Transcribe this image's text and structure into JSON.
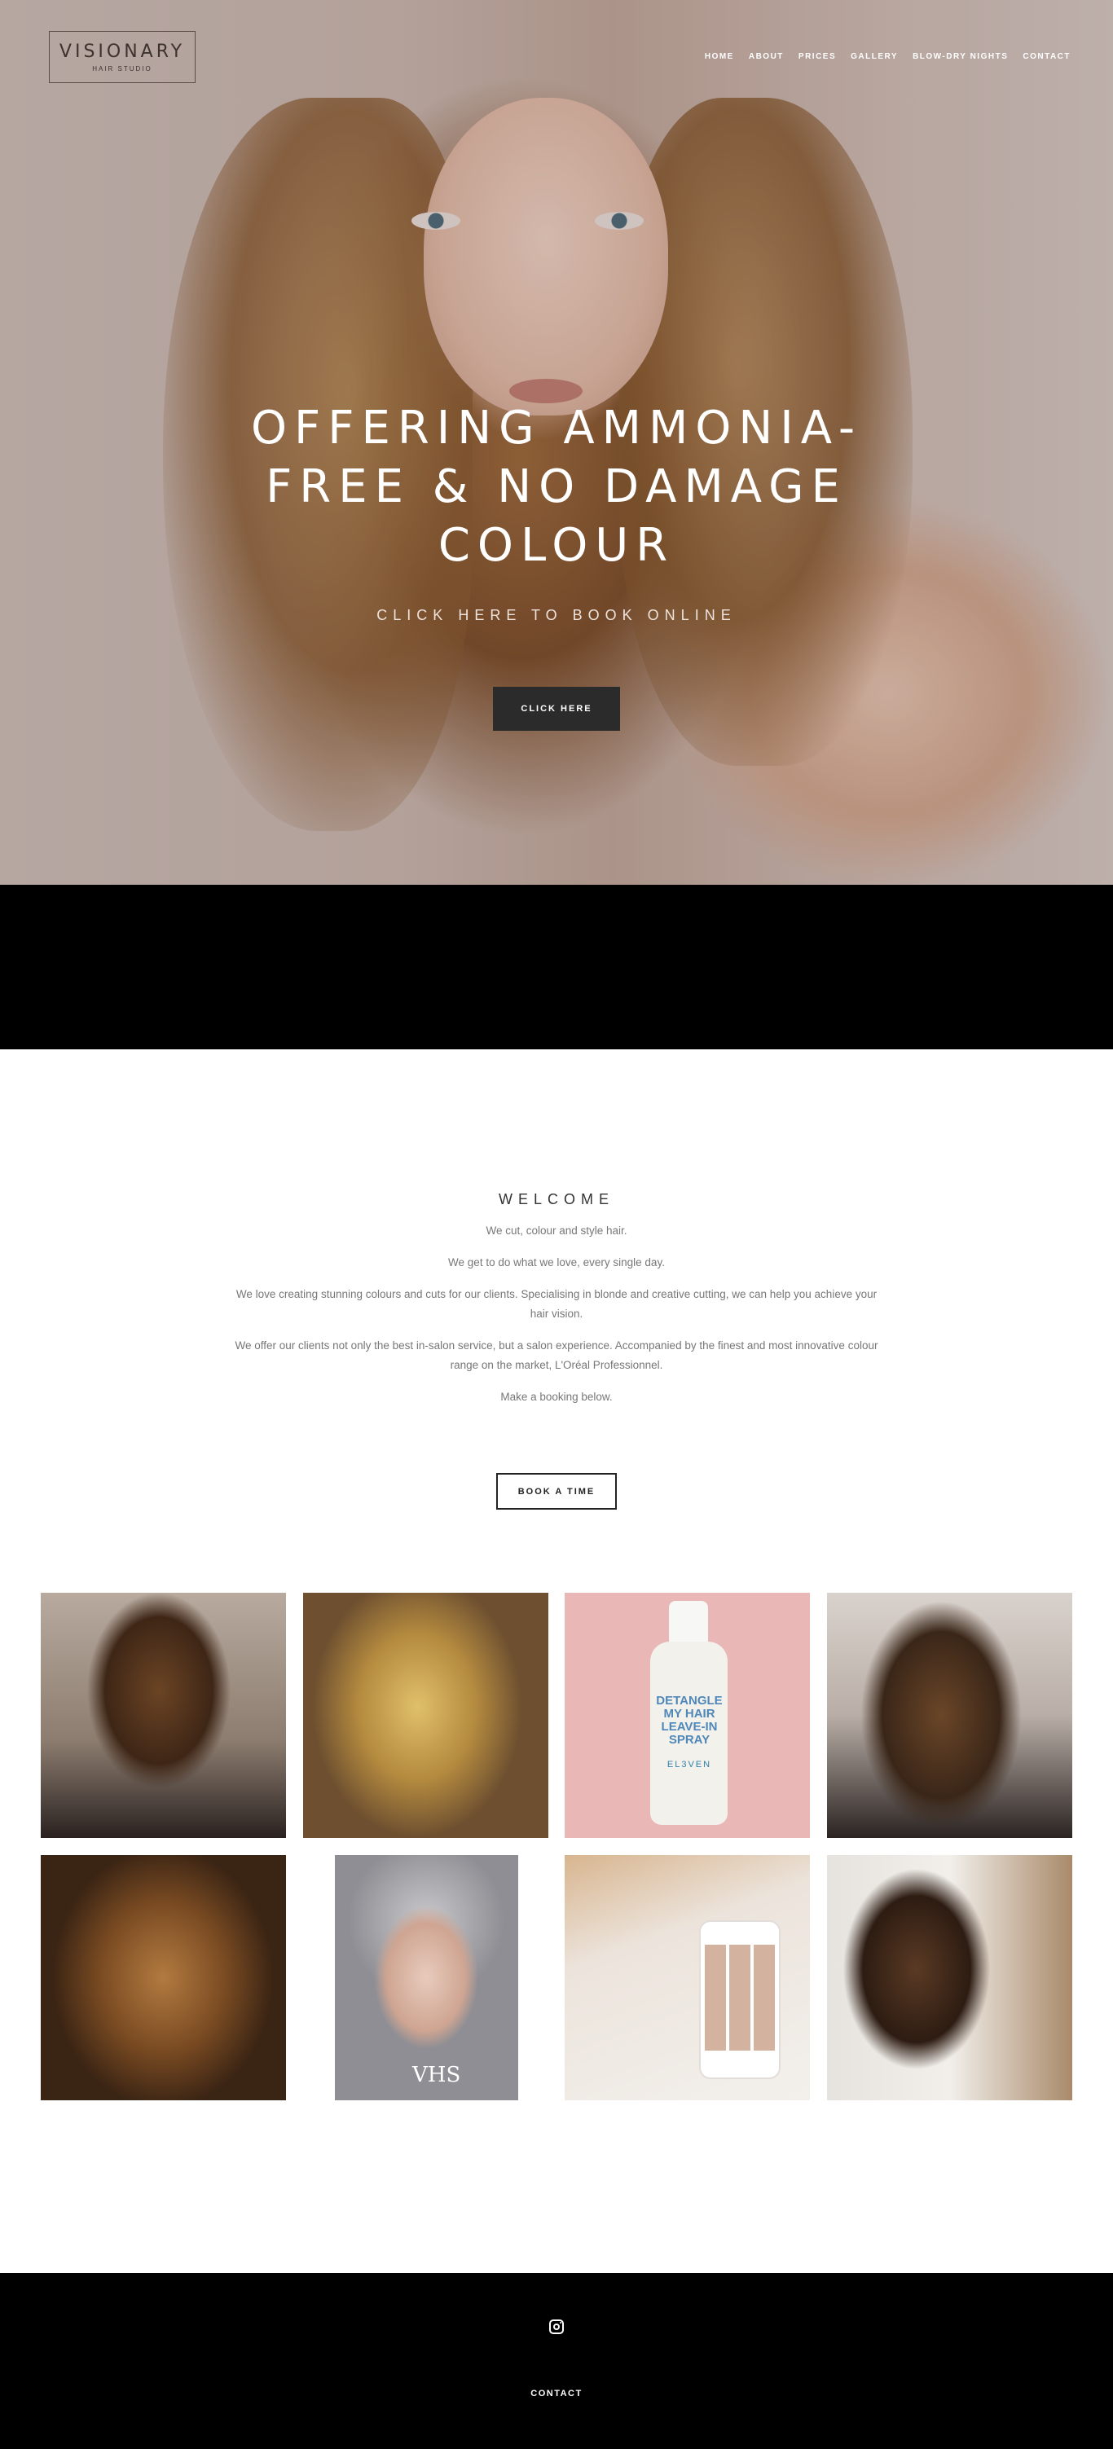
{
  "brand": {
    "name": "VISIONARY",
    "subtitle": "HAIR STUDIO"
  },
  "nav": {
    "items": [
      {
        "label": "HOME"
      },
      {
        "label": "ABOUT"
      },
      {
        "label": "PRICES"
      },
      {
        "label": "GALLERY"
      },
      {
        "label": "BLOW-DRY NIGHTS"
      },
      {
        "label": "CONTACT"
      }
    ]
  },
  "hero": {
    "title": "OFFERING AMMONIA-FREE & NO DAMAGE COLOUR",
    "subtitle": "CLICK HERE TO BOOK ONLINE",
    "button_label": "CLICK HERE"
  },
  "welcome": {
    "heading": "WELCOME",
    "paragraphs": [
      "We cut, colour and style hair.",
      "We get to do what we love, every single day.",
      "We love creating stunning colours and cuts for our clients. Specialising in blonde and creative cutting, we can help you achieve your hair vision.",
      "We offer our clients not only the best in-salon service, but a salon experience. Accompanied by the finest and most innovative colour range on the market, L'Oréal Professionnel.",
      "Make a booking below."
    ],
    "button_label": "BOOK A TIME"
  },
  "gallery": {
    "product_text": "DETANGLE MY HAIR LEAVE-IN SPRAY",
    "product_brand": "EL3VEN",
    "monogram": "VHS"
  },
  "footer": {
    "link_label": "CONTACT",
    "icon": "instagram-icon"
  },
  "colors": {
    "footer_bg": "#000000",
    "button_dark": "#2b2b2b",
    "product_pink": "#e8b7b6"
  }
}
